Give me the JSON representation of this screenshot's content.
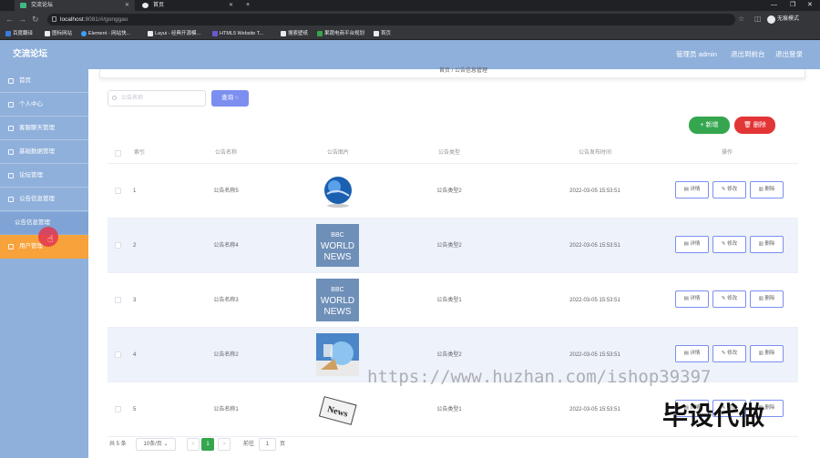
{
  "browser": {
    "tabs": [
      {
        "label": "交流论坛"
      },
      {
        "label": "首页"
      }
    ],
    "new_tab": "+",
    "url_host": "localhost",
    "url_path": ":8081/#/gonggao",
    "profile": "无痕模式",
    "bookmarks": [
      "百度翻译",
      "图标网站",
      "Element - 网站快...",
      "Layui - 经典开源模...",
      "HTML5 Website T...",
      "搜索壁纸",
      "果蔬电商平台规划",
      "首页"
    ]
  },
  "header": {
    "title": "交流论坛",
    "admin": "管理员 admin",
    "back_frontend": "退出到前台",
    "logout": "退出登录"
  },
  "sidebar": {
    "items": [
      {
        "label": "首页"
      },
      {
        "label": "个人中心"
      },
      {
        "label": "客服聊天管理"
      },
      {
        "label": "基础数据管理"
      },
      {
        "label": "论坛管理"
      },
      {
        "label": "公告信息管理"
      }
    ],
    "sub_item": "公告信息管理",
    "user_mgmt": "用户管理"
  },
  "main": {
    "breadcrumb": "首页 / 公告信息管理",
    "search_placeholder": "公告名称",
    "query_label": "查询",
    "add_label": "新增",
    "delete_label": "删除",
    "columns": [
      "索引",
      "公告名称",
      "公告图片",
      "公告类型",
      "公告发布时间",
      "操作"
    ],
    "rows": [
      {
        "index": "1",
        "name": "公告名称5",
        "image": "globe",
        "type": "公告类型2",
        "time": "2022-03-05 15:53:51"
      },
      {
        "index": "2",
        "name": "公告名称4",
        "image": "bbc-world-news",
        "type": "公告类型2",
        "time": "2022-03-05 15:53:51"
      },
      {
        "index": "3",
        "name": "公告名称3",
        "image": "bbc-world-news",
        "type": "公告类型1",
        "time": "2022-03-05 15:53:51"
      },
      {
        "index": "4",
        "name": "公告名称2",
        "image": "news-globe",
        "type": "公告类型2",
        "time": "2022-03-05 15:53:51"
      },
      {
        "index": "5",
        "name": "公告名称1",
        "image": "news-paper",
        "type": "公告类型1",
        "time": "2022-03-05 15:53:51"
      }
    ],
    "action_detail": "详情",
    "action_edit": "修改",
    "action_delete": "删除",
    "bbc_line1": "BBC",
    "bbc_line2": "WORLD",
    "bbc_line3": "NEWS",
    "news_text": "News"
  },
  "pagination": {
    "total": "共 5 条",
    "page_size": "10条/页",
    "prev": "<",
    "current": "1",
    "next": ">",
    "goto_prefix": "前往",
    "goto_value": "1",
    "goto_suffix": "页"
  },
  "watermarks": {
    "url": "https://www.huzhan.com/ishop39397",
    "text": "毕设代做"
  }
}
